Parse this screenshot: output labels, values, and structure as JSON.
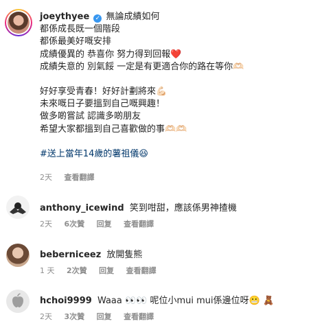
{
  "post": {
    "username": "joeythyee",
    "caption_first": "無論成績如何",
    "lines": [
      "都係成長既一個階段",
      "都係最美好嘅安排",
      "成績優異的 恭喜你 努力得到回報❤️",
      "成績失意的 別氣餒 一定是有更適合你的路在等你🫶🏻",
      "",
      "好好享受青春！好好計劃將來💪🏻",
      "未來嘅日子要搵到自己嘅興趣！",
      "做多啲嘗試 認識多啲朋友",
      "希望大家都搵到自己喜歡做的事🫶🏻🫶🏻"
    ],
    "hashtag": "#送上當年14歲的薯祖儀😆",
    "time": "2天",
    "translate": "查看翻譯"
  },
  "comments": [
    {
      "username": "anthony_icewind",
      "text": "笑到咁甜，應該係男神揸機",
      "time": "2天",
      "likes": "6次贊",
      "reply": "回复",
      "translate": "查看翻譯"
    },
    {
      "username": "beberniceez",
      "text": "放開隻熊",
      "time": "1 天",
      "likes": "2次贊",
      "reply": "回复",
      "translate": "查看翻譯"
    },
    {
      "username": "hchoi9999",
      "text": "Waaa 👀👀 呢位小mui mui係邊位呀😬 🧸",
      "time": "2天",
      "likes": "3次贊",
      "reply": "回复",
      "translate": "查看翻譯"
    }
  ]
}
